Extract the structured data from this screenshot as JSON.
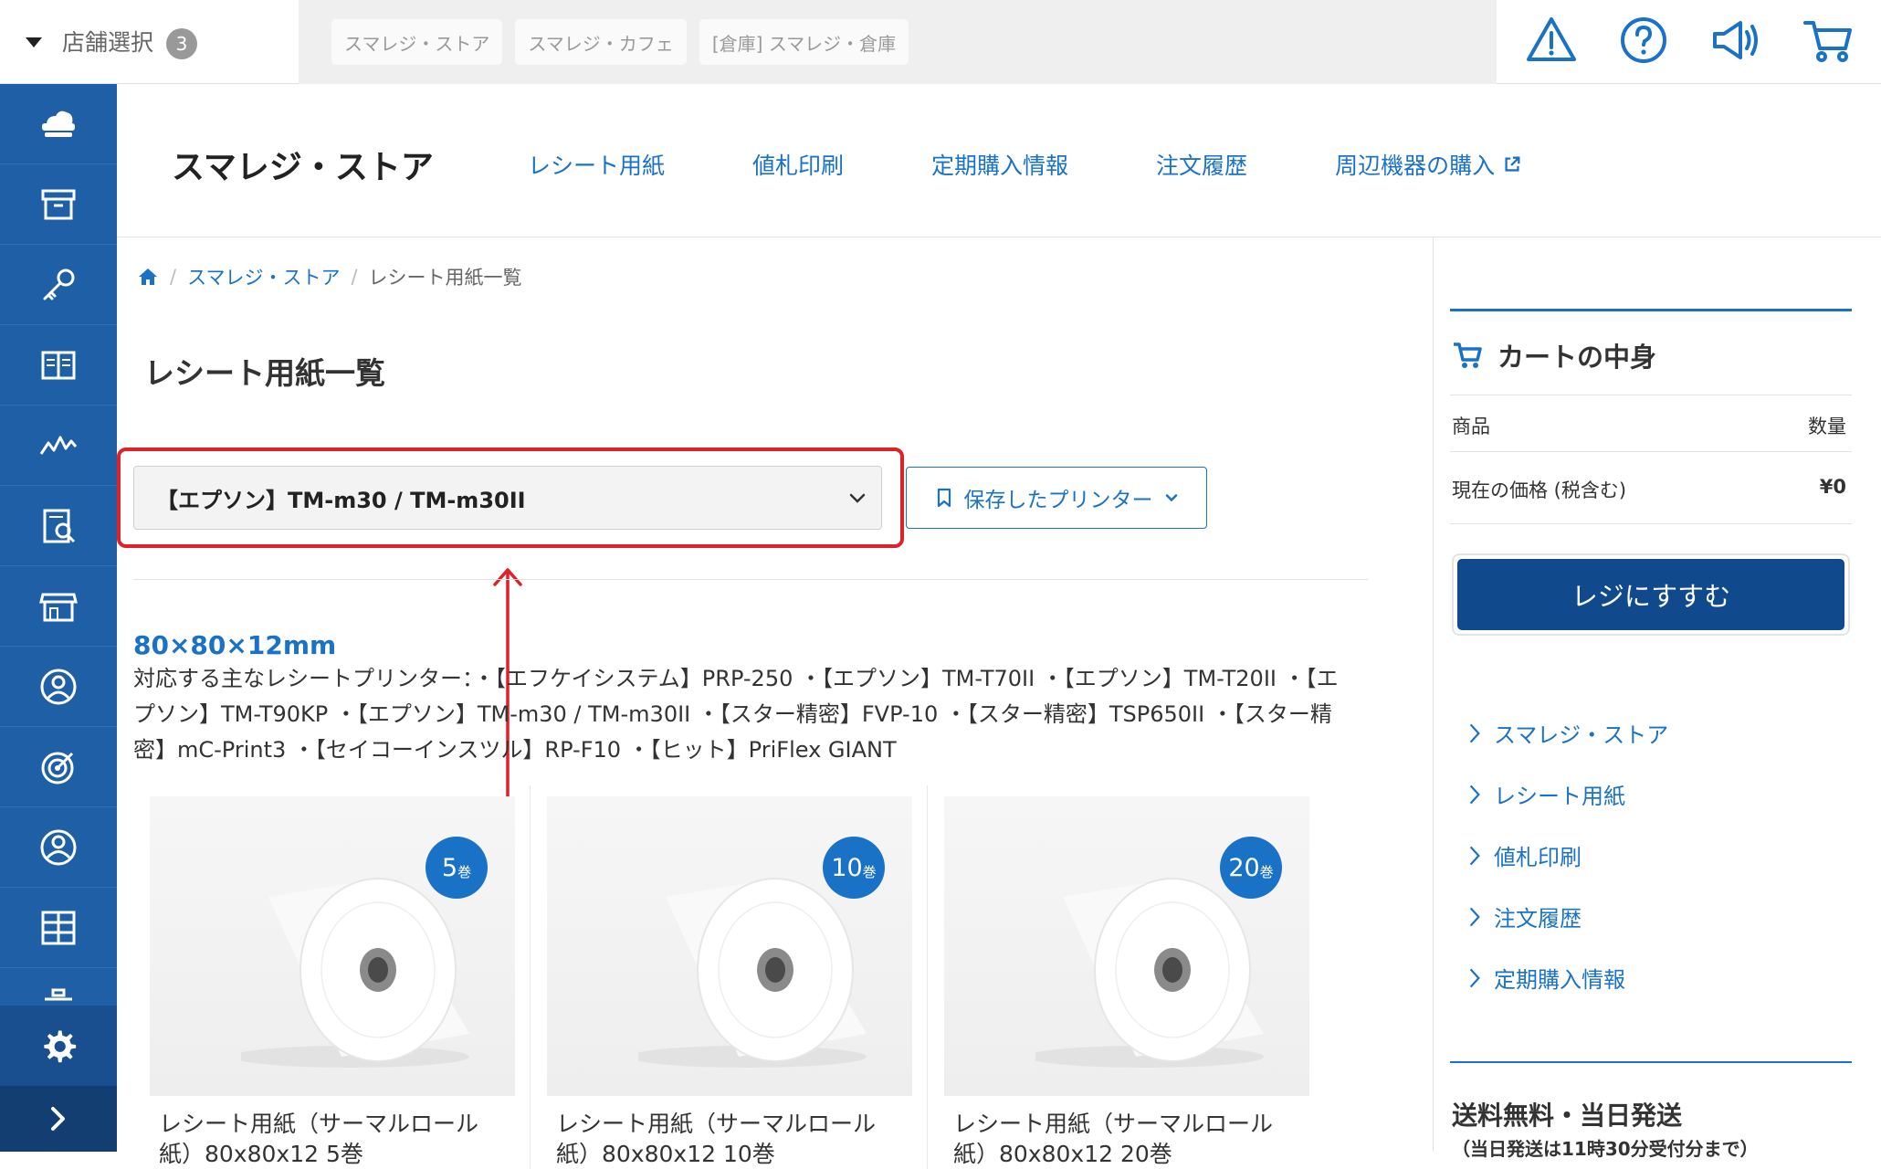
{
  "topbar": {
    "store_select_label": "店舗選択",
    "store_count": "3",
    "store_tabs": [
      "スマレジ・ストア",
      "スマレジ・カフェ",
      "[倉庫] スマレジ・倉庫"
    ],
    "icons": [
      "warning-icon",
      "help-icon",
      "announcement-icon",
      "cart-icon"
    ]
  },
  "sidebar": {
    "icons": [
      "cloud-register-icon",
      "inventory-box-icon",
      "key-icon",
      "book-icon",
      "analytics-icon",
      "report-icon",
      "store-icon",
      "customer-icon",
      "target-icon",
      "user-icon",
      "apps-icon",
      "briefcase-icon"
    ],
    "settings_icon": "gear-icon",
    "expand_icon": "chevron-right-icon"
  },
  "header": {
    "store_title": "スマレジ・ストア",
    "nav": [
      "レシート用紙",
      "値札印刷",
      "定期購入情報",
      "注文履歴",
      "周辺機器の購入"
    ]
  },
  "breadcrumb": {
    "home_icon": "home-icon",
    "level1": "スマレジ・ストア",
    "current": "レシート用紙一覧"
  },
  "main": {
    "page_title": "レシート用紙一覧",
    "printer_select_value": "【エプソン】TM-m30 / TM-m30II",
    "saved_printer_label": "保存したプリンター",
    "size_heading": "80×80×12mm",
    "compat_text": "対応する主なレシートプリンター：・【エフケイシステム】PRP-250 ・【エプソン】TM-T70II ・【エプソン】TM-T20II ・【エプソン】TM-T90KP ・【エプソン】TM-m30 / TM-m30II ・【スター精密】FVP-10 ・【スター精密】TSP650II ・【スター精密】mC-Print3 ・【セイコーインスツル】RP-F10 ・【ヒット】PriFlex GIANT",
    "products": [
      {
        "qty": "5",
        "unit": "巻",
        "name_line1": "レシート用紙（サーマルロール",
        "name_line2": "紙）80x80x12 5巻"
      },
      {
        "qty": "10",
        "unit": "巻",
        "name_line1": "レシート用紙（サーマルロール",
        "name_line2": "紙）80x80x12 10巻"
      },
      {
        "qty": "20",
        "unit": "巻",
        "name_line1": "レシート用紙（サーマルロール",
        "name_line2": "紙）80x80x12 20巻"
      }
    ]
  },
  "cart": {
    "title": "カートの中身",
    "col_item": "商品",
    "col_qty": "数量",
    "price_label": "現在の価格 (税含む)",
    "price_value": "¥0",
    "checkout_label": "レジにすすむ",
    "links": [
      "スマレジ・ストア",
      "レシート用紙",
      "値札印刷",
      "注文履歴",
      "定期購入情報"
    ],
    "ship_title": "送料無料・当日発送",
    "ship_sub": "（当日発送は11時30分受付分まで）"
  },
  "colors": {
    "sidebar": "#1f5fa6",
    "accent": "#1a72c7",
    "checkout": "#114a8c",
    "highlight": "#e0212b"
  }
}
